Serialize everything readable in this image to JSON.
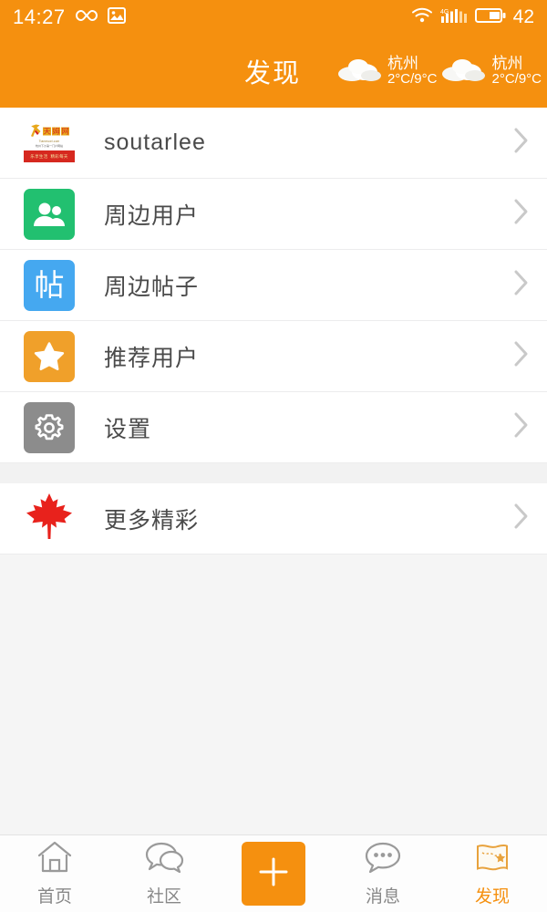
{
  "status_bar": {
    "time": "14:27",
    "icons": [
      "infinity-icon",
      "gallery-icon",
      "wifi-icon",
      "signal-4g-icon",
      "battery-icon"
    ],
    "signal_label": "4G",
    "battery_level": "42"
  },
  "header": {
    "title": "发现",
    "background_color": "#F5900F",
    "weather": [
      {
        "city": "杭州",
        "temp": "2°C/9°C",
        "icon": "cloud-icon"
      },
      {
        "city": "杭州",
        "temp": "2°C/9°C",
        "icon": "cloud-icon"
      }
    ]
  },
  "brand_logo": {
    "word_chars": [
      "天",
      "姆",
      "网"
    ],
    "site": "Tianmuwl.com",
    "tagline": "杭州下沙第一门户网站",
    "band_text": [
      "乐享生活",
      "精彩每天"
    ]
  },
  "list_group_1": [
    {
      "label": "soutarlee",
      "icon": "brand-logo-icon",
      "icon_style": "logo",
      "chevron": "chevron-right-icon"
    },
    {
      "label": "周边用户",
      "icon": "people-icon",
      "icon_style": "green",
      "color": "#22C070",
      "chevron": "chevron-right-icon"
    },
    {
      "label": "周边帖子",
      "icon": "post-icon",
      "icon_style": "blue",
      "color": "#45A8F0",
      "glyph": "帖",
      "chevron": "chevron-right-icon"
    },
    {
      "label": "推荐用户",
      "icon": "star-icon",
      "icon_style": "orange",
      "color": "#F0A02A",
      "chevron": "chevron-right-icon"
    },
    {
      "label": "设置",
      "icon": "gear-icon",
      "icon_style": "gray",
      "color": "#8C8C8C",
      "chevron": "chevron-right-icon"
    }
  ],
  "list_group_2": [
    {
      "label": "更多精彩",
      "icon": "maple-leaf-icon",
      "icon_style": "leaf",
      "color": "#E8221C",
      "chevron": "chevron-right-icon"
    }
  ],
  "tab_bar": [
    {
      "label": "首页",
      "icon": "home-icon",
      "active": false
    },
    {
      "label": "社区",
      "icon": "chat-bubbles-icon",
      "active": false
    },
    {
      "label": "",
      "icon": "plus-icon",
      "active": false,
      "is_button": true
    },
    {
      "label": "消息",
      "icon": "message-dots-icon",
      "active": false
    },
    {
      "label": "发现",
      "icon": "map-icon",
      "active": true
    }
  ],
  "theme": {
    "accent": "#F5900F",
    "page_bg": "#F5F5F5",
    "row_bg": "#FFFFFF",
    "text": "#4A4A4A"
  }
}
